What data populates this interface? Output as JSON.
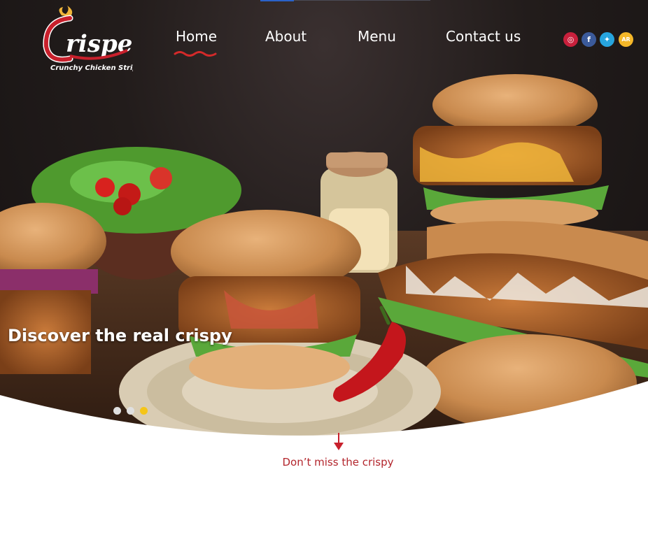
{
  "brand": {
    "name": "Crisper",
    "subtitle": "Crunchy Chicken Strips"
  },
  "nav": {
    "items": [
      {
        "label": "Home",
        "active": true
      },
      {
        "label": "About"
      },
      {
        "label": "Menu"
      },
      {
        "label": "Contact us"
      }
    ]
  },
  "social": {
    "items": [
      {
        "icon": "instagram-icon",
        "glyph": "◎",
        "color": "#c8203c"
      },
      {
        "icon": "facebook-icon",
        "glyph": "f",
        "color": "#3b5a9a"
      },
      {
        "icon": "twitter-icon",
        "glyph": "✦",
        "color": "#27a4dd"
      },
      {
        "icon": "language-ar-icon",
        "glyph": "AR",
        "color": "#f5b729"
      }
    ]
  },
  "hero": {
    "tagline": "Discover the real crispy",
    "slides_total": 3,
    "active_slide": 3
  },
  "section": {
    "cta_text": "Don’t miss the crispy"
  },
  "colors": {
    "accent_red": "#b3252c",
    "active_dot": "#f5c518"
  }
}
